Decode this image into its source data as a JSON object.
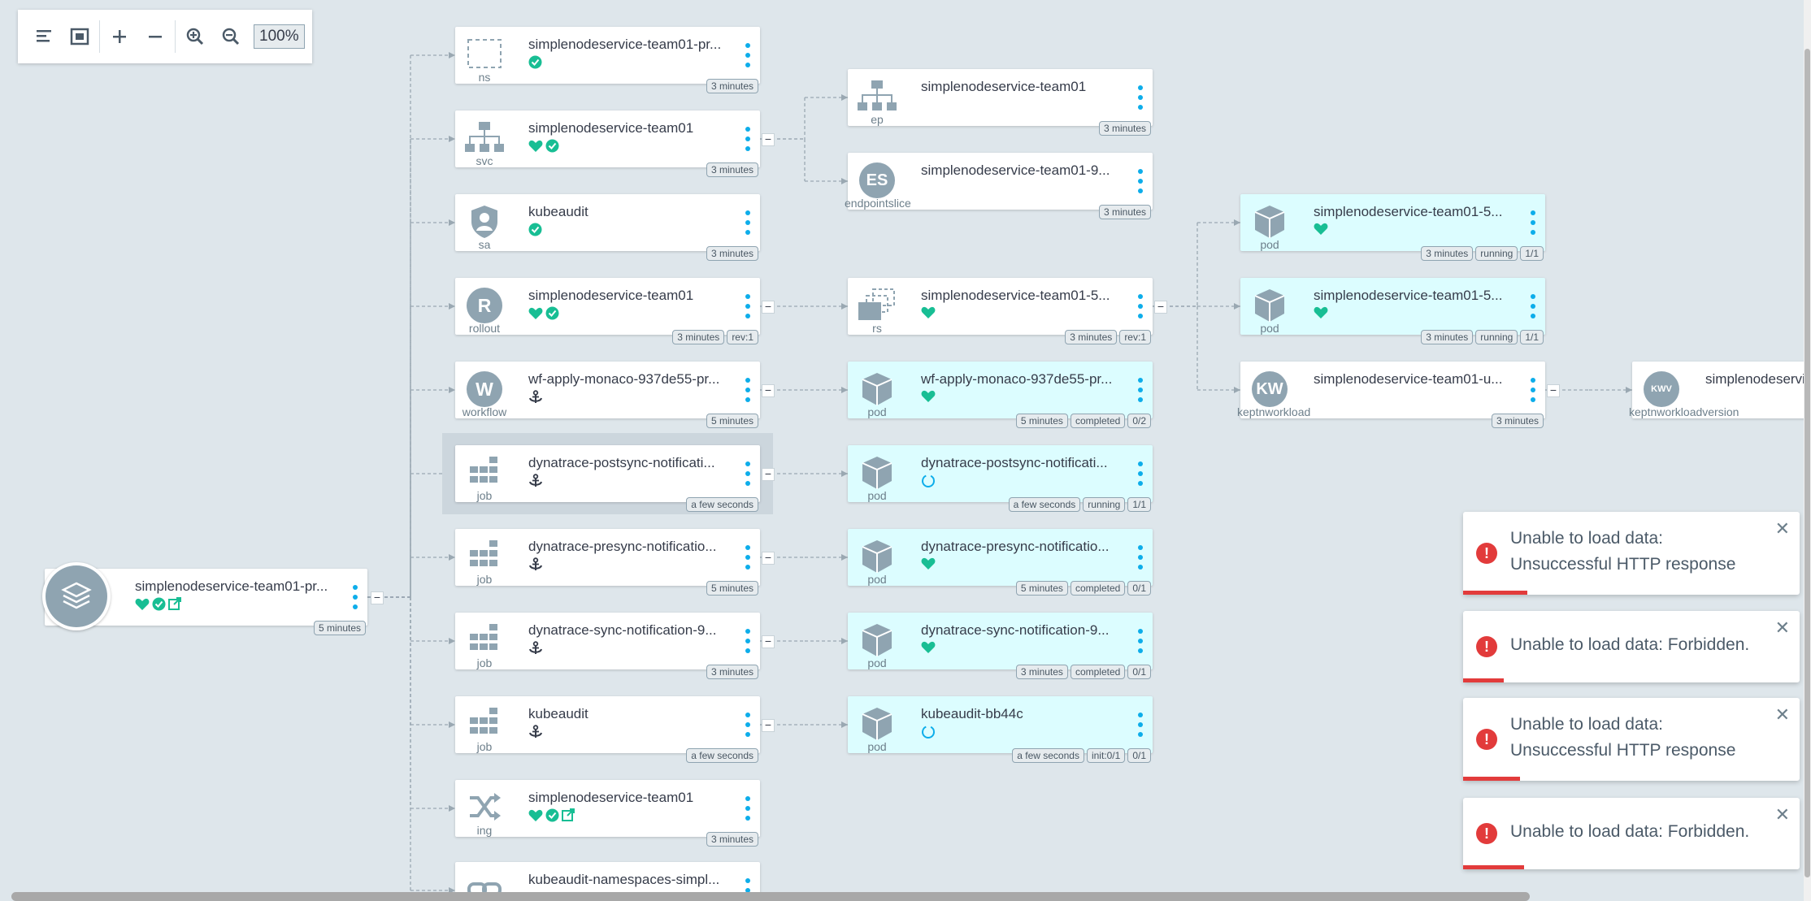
{
  "toolbar": {
    "zoom_level": "100%",
    "buttons": [
      "align-left-icon",
      "fit-view-icon",
      "expand-icon",
      "collapse-icon",
      "zoom-in-icon",
      "zoom-out-icon"
    ]
  },
  "app": {
    "name": "simplenodeservice-team01-pr...",
    "age": "5 minutes"
  },
  "nodes": [
    {
      "id": "ns",
      "name": "simplenodeservice-team01-pr...",
      "kind": "ns",
      "icon": "namespace-icon",
      "status": [
        "synced"
      ],
      "tags": [
        "3 minutes"
      ]
    },
    {
      "id": "svc",
      "name": "simplenodeservice-team01",
      "kind": "svc",
      "icon": "service-icon",
      "status": [
        "healthy",
        "synced"
      ],
      "tags": [
        "3 minutes"
      ]
    },
    {
      "id": "sa",
      "name": "kubeaudit",
      "kind": "sa",
      "icon": "service-account-icon",
      "status": [
        "synced"
      ],
      "tags": [
        "3 minutes"
      ]
    },
    {
      "id": "rollout",
      "name": "simplenodeservice-team01",
      "kind": "rollout",
      "icon": "R",
      "status": [
        "healthy",
        "synced"
      ],
      "tags": [
        "3 minutes",
        "rev:1"
      ]
    },
    {
      "id": "workflow",
      "name": "wf-apply-monaco-937de55-pr...",
      "kind": "workflow",
      "icon": "W",
      "status": [
        "hook"
      ],
      "tags": [
        "5 minutes"
      ]
    },
    {
      "id": "job1",
      "name": "dynatrace-postsync-notificati...",
      "kind": "job",
      "icon": "job-icon",
      "status": [
        "hook"
      ],
      "tags": [
        "a few seconds"
      ]
    },
    {
      "id": "job2",
      "name": "dynatrace-presync-notificatio...",
      "kind": "job",
      "icon": "job-icon",
      "status": [
        "hook"
      ],
      "tags": [
        "5 minutes"
      ]
    },
    {
      "id": "job3",
      "name": "dynatrace-sync-notification-9...",
      "kind": "job",
      "icon": "job-icon",
      "status": [
        "hook"
      ],
      "tags": [
        "3 minutes"
      ]
    },
    {
      "id": "job4",
      "name": "kubeaudit",
      "kind": "job",
      "icon": "job-icon",
      "status": [
        "hook"
      ],
      "tags": [
        "a few seconds"
      ]
    },
    {
      "id": "ing",
      "name": "simplenodeservice-team01",
      "kind": "ing",
      "icon": "ingress-icon",
      "status": [
        "healthy",
        "synced",
        "external-link"
      ],
      "tags": [
        "3 minutes"
      ]
    },
    {
      "id": "ns2",
      "name": "kubeaudit-namespaces-simpl...",
      "kind": "",
      "icon": "link-icon",
      "status": [],
      "tags": []
    },
    {
      "id": "ep",
      "name": "simplenodeservice-team01",
      "kind": "ep",
      "icon": "endpoints-icon",
      "status": [],
      "tags": [
        "3 minutes"
      ]
    },
    {
      "id": "es",
      "name": "simplenodeservice-team01-9...",
      "kind": "endpointslice",
      "icon": "ES",
      "status": [],
      "tags": [
        "3 minutes"
      ]
    },
    {
      "id": "rs",
      "name": "simplenodeservice-team01-5...",
      "kind": "rs",
      "icon": "replicaset-icon",
      "status": [
        "healthy"
      ],
      "tags": [
        "3 minutes",
        "rev:1"
      ]
    },
    {
      "id": "pod1",
      "name": "wf-apply-monaco-937de55-pr...",
      "kind": "pod",
      "icon": "pod-icon",
      "status": [
        "healthy"
      ],
      "tags": [
        "5 minutes",
        "completed",
        "0/2"
      ]
    },
    {
      "id": "pod2",
      "name": "dynatrace-postsync-notificati...",
      "kind": "pod",
      "icon": "pod-icon",
      "status": [
        "progressing"
      ],
      "tags": [
        "a few seconds",
        "running",
        "1/1"
      ]
    },
    {
      "id": "pod3",
      "name": "dynatrace-presync-notificatio...",
      "kind": "pod",
      "icon": "pod-icon",
      "status": [
        "healthy"
      ],
      "tags": [
        "5 minutes",
        "completed",
        "0/1"
      ]
    },
    {
      "id": "pod4",
      "name": "dynatrace-sync-notification-9...",
      "kind": "pod",
      "icon": "pod-icon",
      "status": [
        "healthy"
      ],
      "tags": [
        "3 minutes",
        "completed",
        "0/1"
      ]
    },
    {
      "id": "pod5",
      "name": "kubeaudit-bb44c",
      "kind": "pod",
      "icon": "pod-icon",
      "status": [
        "progressing"
      ],
      "tags": [
        "a few seconds",
        "init:0/1",
        "0/1"
      ]
    },
    {
      "id": "pod6",
      "name": "simplenodeservice-team01-5...",
      "kind": "pod",
      "icon": "pod-icon",
      "status": [
        "healthy"
      ],
      "tags": [
        "3 minutes",
        "running",
        "1/1"
      ]
    },
    {
      "id": "pod7",
      "name": "simplenodeservice-team01-5...",
      "kind": "pod",
      "icon": "pod-icon",
      "status": [
        "healthy"
      ],
      "tags": [
        "3 minutes",
        "running",
        "1/1"
      ]
    },
    {
      "id": "kw",
      "name": "simplenodeservice-team01-u...",
      "kind": "keptnworkload",
      "icon": "KW",
      "status": [],
      "tags": [
        "3 minutes"
      ]
    },
    {
      "id": "kwv",
      "name": "simplenodeservi",
      "kind": "keptnworkloadversion",
      "icon": "KWV",
      "status": [],
      "tags": []
    }
  ],
  "notifications": [
    {
      "message": "Unable to load data: Unsuccessful HTTP response",
      "progress": 0.19
    },
    {
      "message": "Unable to load data: Forbidden.",
      "progress": 0.12
    },
    {
      "message": "Unable to load data: Unsuccessful HTTP response",
      "progress": 0.17
    },
    {
      "message": "Unable to load data: Forbidden.",
      "progress": 0.18
    }
  ],
  "colors": {
    "healthy": "#18be94",
    "synced": "#18be94",
    "progressing": "#0dadea",
    "error": "#e23b3b",
    "accent": "#0dadea"
  }
}
